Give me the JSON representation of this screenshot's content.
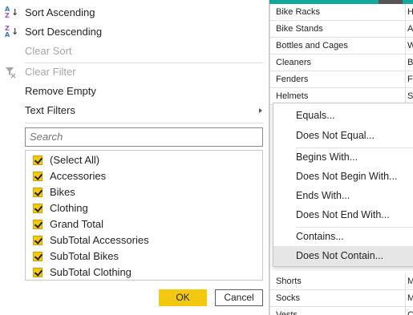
{
  "grid": {
    "rows_top": [
      {
        "c1": "Bike Racks",
        "c2": "Hi"
      },
      {
        "c1": "Bike Stands",
        "c2": "Al"
      },
      {
        "c1": "Bottles and Cages",
        "c2": "W"
      },
      {
        "c1": "Cleaners",
        "c2": "Bi"
      },
      {
        "c1": "Fenders",
        "c2": "Fe"
      },
      {
        "c1": "Helmets",
        "c2": "Sp"
      }
    ],
    "rows_bottom": [
      {
        "c1": "Shorts",
        "c2": "M"
      },
      {
        "c1": "Socks",
        "c2": "M"
      },
      {
        "c1": "Vests",
        "c2": "Cl"
      }
    ]
  },
  "menu": {
    "sort_ascending": "Sort Ascending",
    "sort_descending": "Sort Descending",
    "clear_sort": "Clear Sort",
    "clear_filter": "Clear Filter",
    "remove_empty": "Remove Empty",
    "text_filters": "Text Filters",
    "search_placeholder": "Search",
    "items": [
      "(Select All)",
      "Accessories",
      "Bikes",
      "Clothing",
      "Grand Total",
      "SubTotal Accessories",
      "SubTotal Bikes",
      "SubTotal Clothing"
    ],
    "ok": "OK",
    "cancel": "Cancel"
  },
  "submenu": {
    "equals": "Equals...",
    "does_not_equal": "Does Not Equal...",
    "begins_with": "Begins With...",
    "does_not_begin_with": "Does Not Begin With...",
    "ends_with": "Ends With...",
    "does_not_end_with": "Does Not End With...",
    "contains": "Contains...",
    "does_not_contain": "Does Not Contain..."
  },
  "colors": {
    "accent": "#f2c811",
    "header_teal": "#13a89e"
  }
}
